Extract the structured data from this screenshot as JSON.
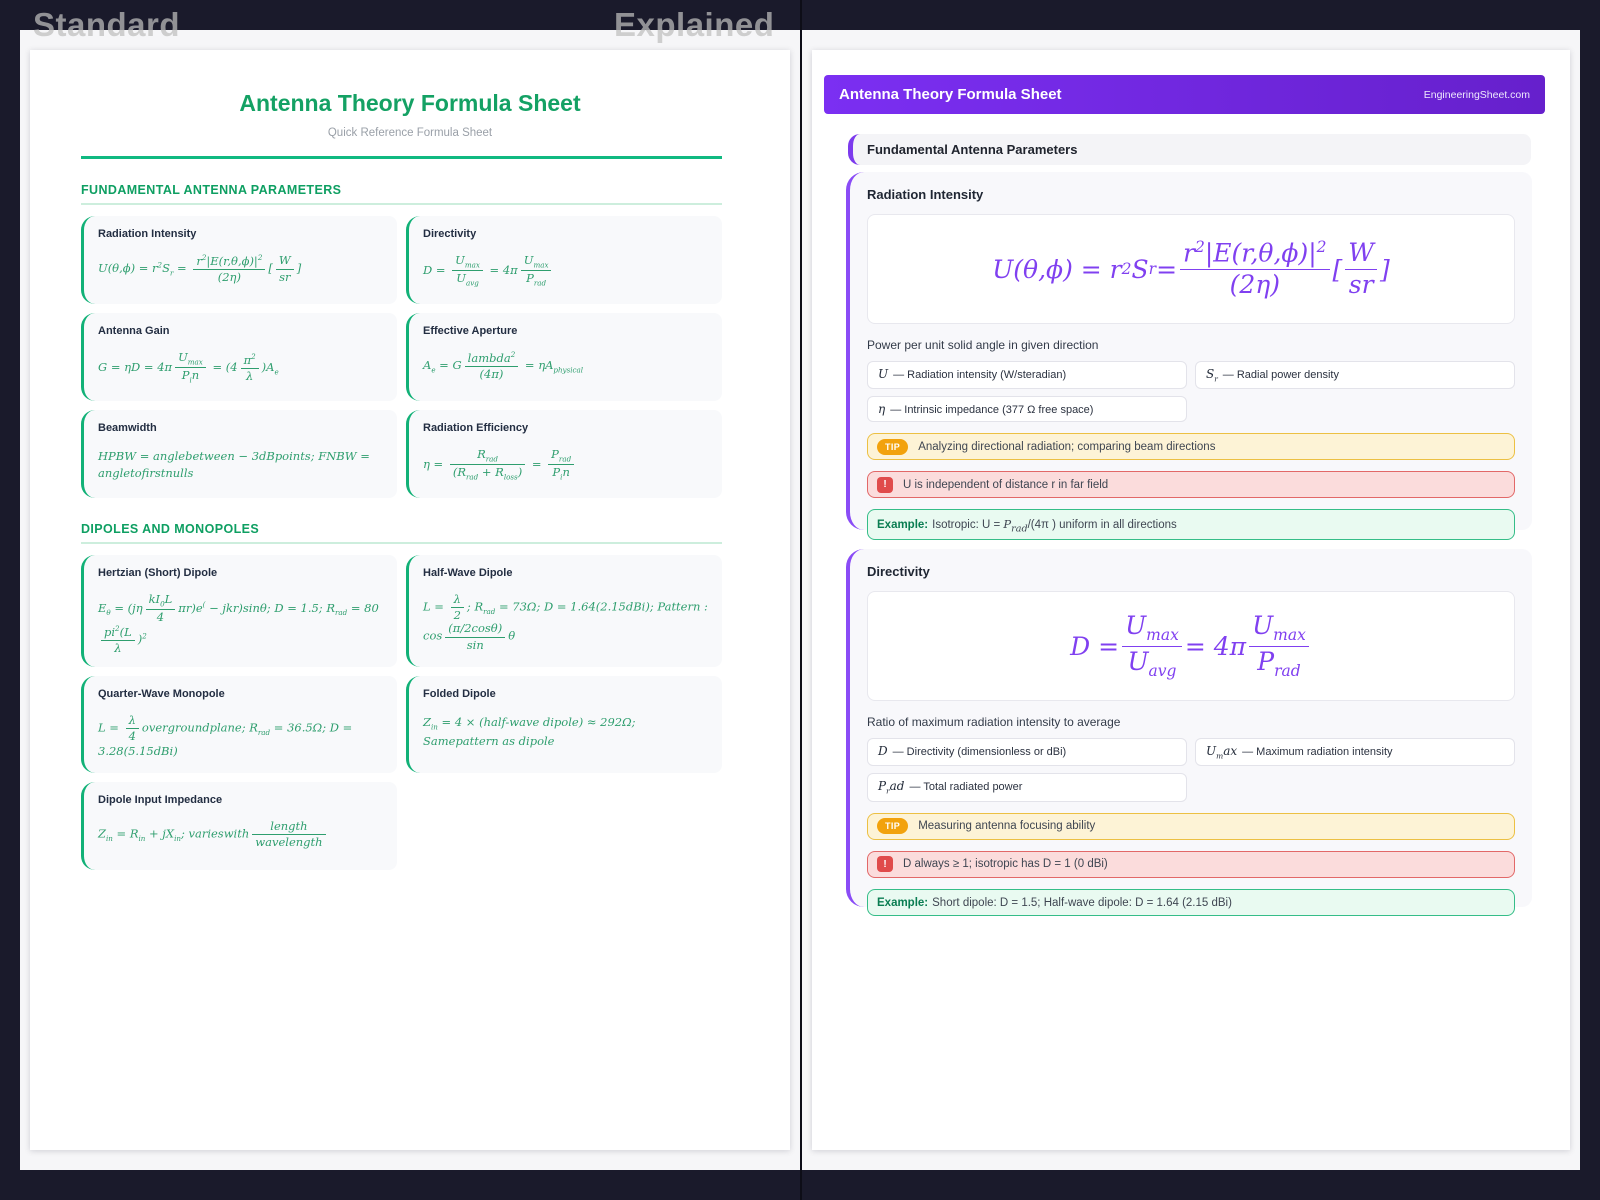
{
  "colors": {
    "background_navy": "#1a1a2b",
    "standard_accent_green": "#10b981",
    "standard_formula_green": "#2e9e6e",
    "explained_accent_purple": "#7c3aed",
    "explained_formula_purple": "#8040f0",
    "tip_orange": "#f2a20d",
    "warning_red": "#e04b4b",
    "example_green": "#35bd88"
  },
  "compare": {
    "left_label": "Standard",
    "right_label": "Explained"
  },
  "left_page": {
    "title": "Antenna Theory Formula Sheet",
    "subtitle": "Quick Reference Formula Sheet",
    "sections": [
      {
        "heading": "FUNDAMENTAL ANTENNA PARAMETERS",
        "cards": [
          {
            "title": "Radiation Intensity",
            "formula": [
              {
                "t": "U(θ,ϕ) = r"
              },
              {
                "sup": "2"
              },
              {
                "t": "S"
              },
              {
                "sub": "r"
              },
              {
                "t": " = "
              },
              {
                "frac": {
                  "n": [
                    {
                      "t": "r"
                    },
                    {
                      "sup": "2"
                    },
                    {
                      "t": "|E(r,θ,ϕ)|"
                    },
                    {
                      "sup": "2"
                    }
                  ],
                  "d": [
                    {
                      "t": "(2η)"
                    }
                  ]
                }
              },
              {
                "t": "["
              },
              {
                "frac": {
                  "n": [
                    {
                      "t": "W"
                    }
                  ],
                  "d": [
                    {
                      "t": "sr"
                    }
                  ]
                }
              },
              {
                "t": "]"
              }
            ]
          },
          {
            "title": "Directivity",
            "formula": [
              {
                "t": "D = "
              },
              {
                "frac": {
                  "n": [
                    {
                      "t": "U"
                    },
                    {
                      "sub": "max"
                    }
                  ],
                  "d": [
                    {
                      "t": "U"
                    },
                    {
                      "sub": "avg"
                    }
                  ]
                }
              },
              {
                "t": " = 4π"
              },
              {
                "frac": {
                  "n": [
                    {
                      "t": "U"
                    },
                    {
                      "sub": "max"
                    }
                  ],
                  "d": [
                    {
                      "t": "P"
                    },
                    {
                      "sub": "rad"
                    }
                  ]
                }
              }
            ]
          },
          {
            "title": "Antenna Gain",
            "formula": [
              {
                "t": "G = ηD = 4π"
              },
              {
                "frac": {
                  "n": [
                    {
                      "t": "U"
                    },
                    {
                      "sub": "max"
                    }
                  ],
                  "d": [
                    {
                      "t": "P"
                    },
                    {
                      "sub": "i"
                    },
                    {
                      "t": "n"
                    }
                  ]
                }
              },
              {
                "t": " = (4"
              },
              {
                "frac": {
                  "n": [
                    {
                      "t": "π"
                    },
                    {
                      "sup": "2"
                    }
                  ],
                  "d": [
                    {
                      "t": "λ"
                    }
                  ]
                }
              },
              {
                "t": ")A"
              },
              {
                "sub": "e"
              }
            ]
          },
          {
            "title": "Effective Aperture",
            "formula": [
              {
                "t": "A"
              },
              {
                "sub": "e"
              },
              {
                "t": " = G"
              },
              {
                "frac": {
                  "n": [
                    {
                      "t": "lambda"
                    },
                    {
                      "sup": "2"
                    }
                  ],
                  "d": [
                    {
                      "t": "(4π)"
                    }
                  ]
                }
              },
              {
                "t": " = ηA"
              },
              {
                "sub": "physical"
              }
            ]
          },
          {
            "title": "Beamwidth",
            "formula": [
              {
                "t": "HPBW = anglebetween − 3dBpoints; FNBW = angletofirstnulls"
              }
            ]
          },
          {
            "title": "Radiation Efficiency",
            "formula": [
              {
                "t": "η = "
              },
              {
                "frac": {
                  "n": [
                    {
                      "t": "R"
                    },
                    {
                      "sub": "rad"
                    }
                  ],
                  "d": [
                    {
                      "t": "(R"
                    },
                    {
                      "sub": "rad"
                    },
                    {
                      "t": " + R"
                    },
                    {
                      "sub": "loss"
                    },
                    {
                      "t": ")"
                    }
                  ]
                }
              },
              {
                "t": " = "
              },
              {
                "frac": {
                  "n": [
                    {
                      "t": "P"
                    },
                    {
                      "sub": "rad"
                    }
                  ],
                  "d": [
                    {
                      "t": "P"
                    },
                    {
                      "sub": "i"
                    },
                    {
                      "t": "n"
                    }
                  ]
                }
              }
            ]
          }
        ]
      },
      {
        "heading": "DIPOLES AND MONOPOLES",
        "cards": [
          {
            "title": "Hertzian (Short) Dipole",
            "formula": [
              {
                "t": "E"
              },
              {
                "sub": "θ"
              },
              {
                "t": " = (jη"
              },
              {
                "frac": {
                  "n": [
                    {
                      "t": "kI"
                    },
                    {
                      "sub": "0"
                    },
                    {
                      "t": "L"
                    }
                  ],
                  "d": [
                    {
                      "t": "4"
                    }
                  ]
                }
              },
              {
                "t": "πr)e"
              },
              {
                "sup": "("
              },
              {
                "t": " − jkr)sinθ; D = 1.5; R"
              },
              {
                "sub": "rad"
              },
              {
                "t": " = 80"
              },
              {
                "frac": {
                  "n": [
                    {
                      "t": "pi"
                    },
                    {
                      "sup": "2"
                    },
                    {
                      "t": "(L"
                    }
                  ],
                  "d": [
                    {
                      "t": "λ"
                    }
                  ]
                }
              },
              {
                "t": ")"
              },
              {
                "sup": "2"
              }
            ]
          },
          {
            "title": "Half-Wave Dipole",
            "formula": [
              {
                "t": "L = "
              },
              {
                "frac": {
                  "n": [
                    {
                      "t": "λ"
                    }
                  ],
                  "d": [
                    {
                      "t": "2"
                    }
                  ]
                }
              },
              {
                "t": "; R"
              },
              {
                "sub": "rad"
              },
              {
                "t": " = 73Ω; D = 1.64(2.15dBi); Pattern : cos"
              },
              {
                "frac": {
                  "n": [
                    {
                      "t": "(π/2cosθ)"
                    }
                  ],
                  "d": [
                    {
                      "t": "sin"
                    }
                  ]
                }
              },
              {
                "t": "θ"
              }
            ]
          },
          {
            "title": "Quarter-Wave Monopole",
            "formula": [
              {
                "t": "L = "
              },
              {
                "frac": {
                  "n": [
                    {
                      "t": "λ"
                    }
                  ],
                  "d": [
                    {
                      "t": "4"
                    }
                  ]
                }
              },
              {
                "t": "overgroundplane; R"
              },
              {
                "sub": "rad"
              },
              {
                "t": " = 36.5Ω; D = 3.28(5.15dBi)"
              }
            ]
          },
          {
            "title": "Folded Dipole",
            "formula": [
              {
                "t": "Z"
              },
              {
                "sub": "in"
              },
              {
                "t": " = 4 × (half-wave dipole) ≈ 292Ω; Samepattern as dipole"
              }
            ]
          },
          {
            "title": "Dipole Input Impedance",
            "formula": [
              {
                "t": "Z"
              },
              {
                "sub": "in"
              },
              {
                "t": " = R"
              },
              {
                "sub": "in"
              },
              {
                "t": " + jX"
              },
              {
                "sub": "in"
              },
              {
                "t": "; varieswith"
              },
              {
                "frac": {
                  "n": [
                    {
                      "t": "length"
                    }
                  ],
                  "d": [
                    {
                      "t": "wavelength"
                    }
                  ]
                }
              }
            ]
          }
        ]
      }
    ]
  },
  "right_page": {
    "header": {
      "title": "Antenna Theory Formula Sheet",
      "site": "EngineeringSheet.com"
    },
    "section_heading": "Fundamental Antenna Parameters",
    "badges": {
      "tip": "TIP",
      "warning": "!",
      "example": "Example:"
    },
    "cards": [
      {
        "title": "Radiation Intensity",
        "formula": [
          {
            "t": "U(θ,ϕ) = r"
          },
          {
            "sup": "2"
          },
          {
            "t": "S"
          },
          {
            "sub": "r"
          },
          {
            "t": " = "
          },
          {
            "frac": {
              "n": [
                {
                  "t": "r"
                },
                {
                  "sup": "2"
                },
                {
                  "t": "|E(r,θ,ϕ)|"
                },
                {
                  "sup": "2"
                }
              ],
              "d": [
                {
                  "t": "(2η)"
                }
              ]
            }
          },
          {
            "t": "["
          },
          {
            "frac": {
              "n": [
                {
                  "t": "W"
                }
              ],
              "d": [
                {
                  "t": "sr"
                }
              ]
            }
          },
          {
            "t": "]"
          }
        ],
        "description": "Power per unit solid angle in given direction",
        "variables": [
          {
            "sym": [
              {
                "t": "U"
              }
            ],
            "desc": "— Radiation intensity (W/steradian)"
          },
          {
            "sym": [
              {
                "t": "S"
              },
              {
                "sub": "r"
              }
            ],
            "desc": "— Radial power density"
          },
          {
            "sym": [
              {
                "t": "η"
              }
            ],
            "desc": "— Intrinsic impedance (377 Ω free space)"
          }
        ],
        "tip": "Analyzing directional radiation; comparing beam directions",
        "warning": "U is independent of distance r in far field",
        "example": [
          {
            "t": "Isotropic: U = "
          },
          {
            "m": [
              {
                "t": "P"
              },
              {
                "sub": "rad"
              }
            ]
          },
          {
            "t": "/(4π ) uniform in all directions"
          }
        ]
      },
      {
        "title": "Directivity",
        "formula": [
          {
            "t": "D = "
          },
          {
            "frac": {
              "n": [
                {
                  "t": "U"
                },
                {
                  "sub": "max"
                }
              ],
              "d": [
                {
                  "t": "U"
                },
                {
                  "sub": "avg"
                }
              ]
            }
          },
          {
            "t": " = 4π"
          },
          {
            "frac": {
              "n": [
                {
                  "t": "U"
                },
                {
                  "sub": "max"
                }
              ],
              "d": [
                {
                  "t": "P"
                },
                {
                  "sub": "rad"
                }
              ]
            }
          }
        ],
        "description": "Ratio of maximum radiation intensity to average",
        "variables": [
          {
            "sym": [
              {
                "t": "D"
              }
            ],
            "desc": "— Directivity (dimensionless or dBi)"
          },
          {
            "sym": [
              {
                "t": "U"
              },
              {
                "sub": "m"
              },
              {
                "t": "ax"
              }
            ],
            "desc": "— Maximum radiation intensity"
          },
          {
            "sym": [
              {
                "t": "P"
              },
              {
                "sub": "r"
              },
              {
                "t": "ad"
              }
            ],
            "desc": "— Total radiated power"
          }
        ],
        "tip": "Measuring antenna focusing ability",
        "warning": "D always ≥ 1; isotropic has D = 1 (0 dBi)",
        "example": [
          {
            "t": "Short dipole: D = 1.5; Half-wave dipole: D = 1.64 (2.15 dBi)"
          }
        ]
      }
    ]
  }
}
